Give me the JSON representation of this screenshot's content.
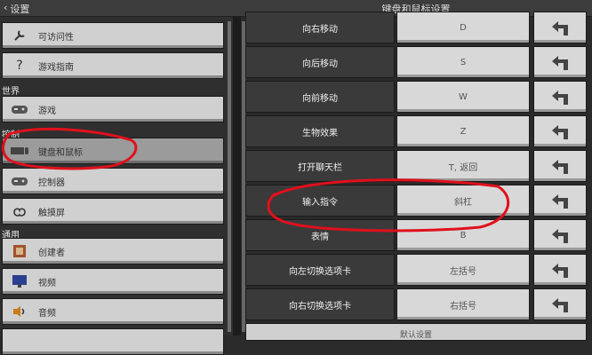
{
  "header": {
    "back_label": "设置",
    "title": "键盘和鼠标设置"
  },
  "sidebar": {
    "top_items": [
      {
        "label": "可访问性",
        "icon": "wrench-icon"
      },
      {
        "label": "游戏指南",
        "icon": "question-mark-icon"
      }
    ],
    "sections": [
      {
        "title": "世界",
        "items": [
          {
            "label": "游戏",
            "icon": "controller-icon"
          }
        ]
      },
      {
        "title": "控制",
        "items": [
          {
            "label": "键盘和鼠标",
            "icon": "keyboard-mouse-icon",
            "selected": true
          },
          {
            "label": "控制器",
            "icon": "controller-icon"
          },
          {
            "label": "触摸屏",
            "icon": "touch-hand-icon"
          }
        ]
      },
      {
        "title": "通用",
        "items": [
          {
            "label": "创建者",
            "icon": "creator-icon"
          },
          {
            "label": "视频",
            "icon": "monitor-icon"
          },
          {
            "label": "音频",
            "icon": "speaker-icon"
          }
        ]
      }
    ]
  },
  "bindings": [
    {
      "action": "向右移动",
      "key": "D"
    },
    {
      "action": "向后移动",
      "key": "S"
    },
    {
      "action": "向前移动",
      "key": "W"
    },
    {
      "action": "生物效果",
      "key": "Z"
    },
    {
      "action": "打开聊天栏",
      "key": "T, 返回"
    },
    {
      "action": "输入指令",
      "key": "斜杠"
    },
    {
      "action": "表情",
      "key": "B"
    },
    {
      "action": "向左切换选项卡",
      "key": "左括号"
    },
    {
      "action": "向右切换选项卡",
      "key": "右括号"
    }
  ],
  "bottom_button": {
    "label": "默认设置"
  },
  "colors": {
    "annotation": "#e0101c"
  }
}
